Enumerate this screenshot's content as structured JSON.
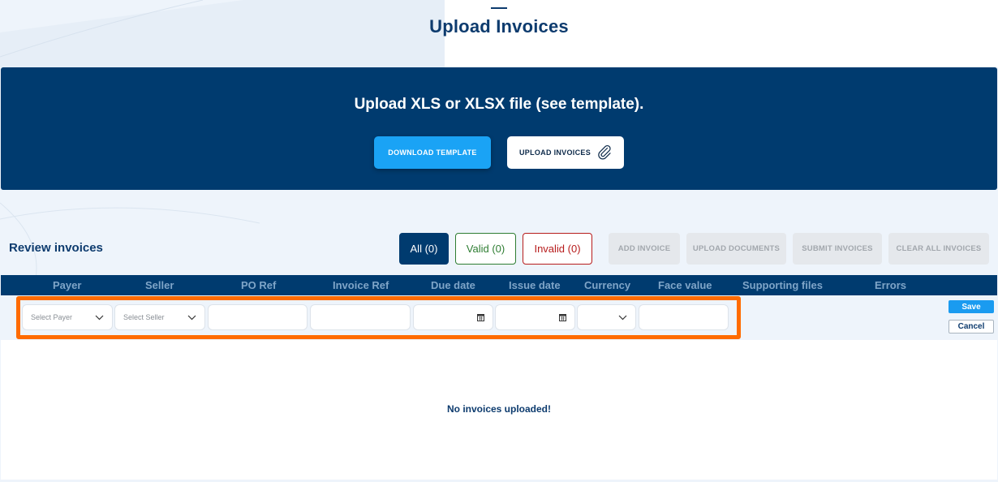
{
  "page": {
    "title": "Upload Invoices"
  },
  "upload": {
    "heading": "Upload XLS or XLSX file (see template).",
    "download_label": "DOWNLOAD TEMPLATE",
    "upload_label": "UPLOAD INVOICES"
  },
  "review": {
    "title": "Review invoices",
    "filters": {
      "all": "All (0)",
      "valid": "Valid (0)",
      "invalid": "Invalid (0)"
    },
    "actions": {
      "add": "ADD INVOICE",
      "upload_docs": "UPLOAD DOCUMENTS",
      "submit": "SUBMIT INVOICES",
      "clear": "CLEAR ALL INVOICES"
    }
  },
  "table": {
    "columns": [
      "Payer",
      "Seller",
      "PO Ref",
      "Invoice Ref",
      "Due date",
      "Issue date",
      "Currency",
      "Face value",
      "Supporting files",
      "Errors"
    ],
    "empty_message": "No invoices uploaded!"
  },
  "edit_row": {
    "payer_placeholder": "Select Payer",
    "seller_placeholder": "Select Seller",
    "po_ref": "",
    "invoice_ref": "",
    "due_date": "",
    "issue_date": "",
    "currency": "",
    "face_value": "",
    "save_label": "Save",
    "cancel_label": "Cancel"
  },
  "colors": {
    "navy": "#003b6f",
    "accent_blue": "#1aa3f5",
    "valid_green": "#2e7d32",
    "invalid_red": "#b71c1c",
    "highlight_orange": "#ff6b00"
  },
  "icons": {
    "upload": "paperclip-icon",
    "select": "chevron-down-icon",
    "date": "calendar-icon"
  }
}
